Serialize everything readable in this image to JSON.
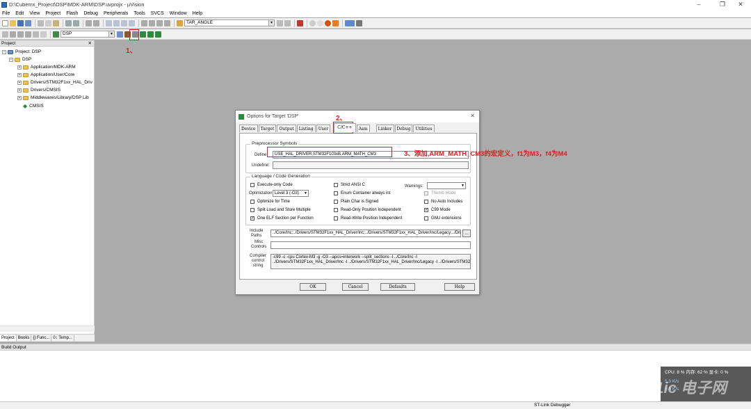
{
  "window": {
    "title": "D:\\Cubemx_Project\\DSP\\MDK-ARM\\DSP.uvprojx - µVision"
  },
  "menu": [
    "File",
    "Edit",
    "View",
    "Project",
    "Flash",
    "Debug",
    "Peripherals",
    "Tools",
    "SVCS",
    "Window",
    "Help"
  ],
  "toolbar": {
    "find_combo": "TAR_ANGLE",
    "target_combo": "DSP"
  },
  "project_pane": {
    "title": "Project",
    "tree": [
      {
        "label": "Project: DSP",
        "level": 0
      },
      {
        "label": "DSP",
        "level": 1
      },
      {
        "label": "Application/MDK-ARM",
        "level": 2
      },
      {
        "label": "Application/User/Core",
        "level": 2
      },
      {
        "label": "Drivers/STM32F1xx_HAL_Driv",
        "level": 2
      },
      {
        "label": "Drivers/CMSIS",
        "level": 2
      },
      {
        "label": "Middlewares/Library/DSP Lib",
        "level": 2
      },
      {
        "label": "CMSIS",
        "level": 2
      }
    ],
    "tabs": [
      "Project",
      "Books",
      "{} Func...",
      "0↓ Temp..."
    ]
  },
  "build_pane": {
    "title": "Build Output"
  },
  "statusbar": {
    "debugger": "ST-Link Debugger"
  },
  "sysmon": {
    "line1": "CPU: 8 %    内存: 62 %    显卡: 0 %",
    "line2": "5.3 K/s",
    "line3": "0.5 K/s"
  },
  "watermark": "21ic 电子网",
  "dialog": {
    "title": "Options for Target 'DSP'",
    "tabs": [
      "Device",
      "Target",
      "Output",
      "Listing",
      "User",
      "C/C++",
      "Asm",
      "Linker",
      "Debug",
      "Utilities"
    ],
    "active_tab": "C/C++",
    "preprocessor": {
      "group_label": "Preprocessor Symbols",
      "define_label": "Define:",
      "define_value": "USE_HAL_DRIVER,STM32F103xB,ARM_MATH_CM3",
      "undefine_label": "Undefine:",
      "undefine_value": ""
    },
    "language": {
      "group_label": "Language / Code Generation",
      "execute_only": "Execute-only Code",
      "optimization_label": "Optimization:",
      "optimization_value": "Level 3 (-O3)",
      "optimize_time": "Optimize for Time",
      "split_load": "Split Load and Store Multiple",
      "one_elf": "One ELF Section per Function",
      "strict_ansi": "Strict ANSI C",
      "enum_container": "Enum Container always int",
      "plain_char": "Plain Char is Signed",
      "ro_pi": "Read-Only Position Independent",
      "rw_pi": "Read-Write Position Independent",
      "warnings_label": "Warnings:",
      "warnings_value": "",
      "thumb_mode": "Thumb Mode",
      "no_auto_includes": "No Auto Includes",
      "c99_mode": "C99 Mode",
      "gnu_ext": "GNU extensions"
    },
    "include_label": "Include\nPaths",
    "include_value": "../Core/Inc;../Drivers/STM32F1xx_HAL_Driver/Inc;../Drivers/STM32F1xx_HAL_Driver/Inc/Legacy;../Drivers/STM32F1xx_HAL_Driver/Inc;",
    "misc_label": "Misc\nControls",
    "misc_value": "",
    "compiler_label": "Compiler\ncontrol\nstring",
    "compiler_line1": "-c99 -c -cpu Cortex-M3 -g -O3 --apcs=interwork --split_sections -I ../Core/Inc -I",
    "compiler_line2": "../Drivers/STM32F1xx_HAL_Driver/Inc -I ../Drivers/STM32F1xx_HAL_Driver/Inc/Legacy -I ../Drivers/STM32F1xx_HAL_Driver/Inc -I",
    "buttons": {
      "ok": "OK",
      "cancel": "Cancel",
      "defaults": "Defaults",
      "help": "Help"
    },
    "browse": "..."
  },
  "annotations": {
    "a1": "1、",
    "a2": "2、",
    "a3": "3、添加,ARM_MATH_CM3的宏定义，f1为M3，f4为M4"
  },
  "colors": {
    "annotation": "#e01b1b",
    "workspace": "#ababab"
  }
}
